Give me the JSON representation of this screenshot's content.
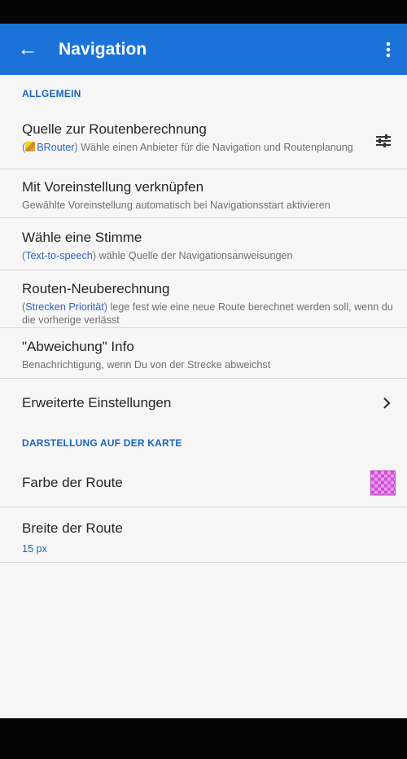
{
  "colors": {
    "status_bar": "#050505",
    "app_bar": "#1b73d9",
    "section_header": "#1b62bf",
    "accent_text": "#2a63c7",
    "route_color": "#d24ed7"
  },
  "app_bar": {
    "title": "Navigation",
    "back_icon": "back-arrow-icon",
    "menu_icon": "overflow-menu-icon"
  },
  "sections": {
    "general": {
      "title": "ALLGEMEIN"
    },
    "map_display": {
      "title": "DARSTELLUNG AUF DER KARTE"
    }
  },
  "prefs": {
    "route_source": {
      "title": "Quelle zur Routenberechnung",
      "summary_open": "(",
      "summary_accent": "BRouter",
      "summary_rest": ") Wähle einen Anbieter für die Navigation und Routenplanung",
      "icon": "sliders-icon"
    },
    "preset": {
      "title": "Mit Voreinstellung verknüpfen",
      "summary": "Gewählte Voreinstellung automatisch bei Navigationsstart aktivieren"
    },
    "voice": {
      "title": "Wähle eine Stimme",
      "summary_open": "(",
      "summary_accent": "Text-to-speech",
      "summary_rest": ") wähle Quelle der Navigationsanweisungen"
    },
    "recalculation": {
      "title": "Routen-Neuberechnung",
      "summary_open": "(",
      "summary_accent": "Strecken Priorität",
      "summary_rest": ") lege fest wie eine neue Route berechnet werden soll, wenn du die vorherige verlässt"
    },
    "deviation": {
      "title": "\"Abweichung\" Info",
      "summary": "Benachrichtigung, wenn Du von der Strecke abweichst"
    },
    "advanced": {
      "title": "Erweiterte Einstellungen",
      "icon": "chevron-right-icon"
    },
    "route_color": {
      "title": "Farbe der Route"
    },
    "route_width": {
      "title": "Breite der Route",
      "value": "15 px"
    }
  }
}
